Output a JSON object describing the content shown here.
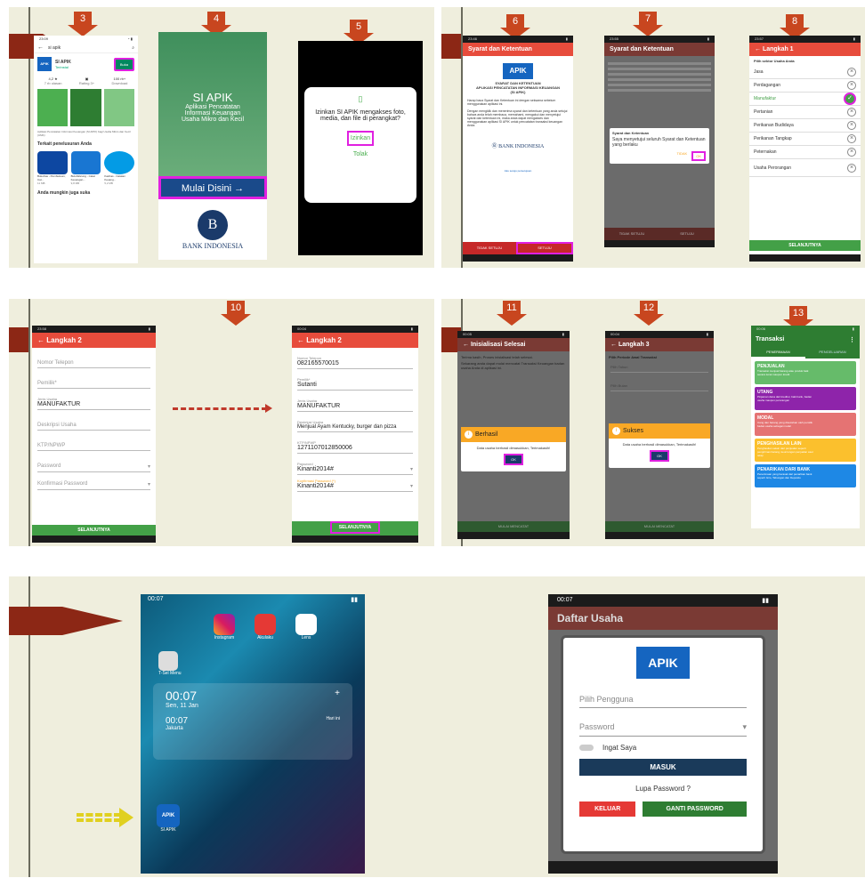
{
  "steps": [
    "3",
    "4",
    "5",
    "6",
    "7",
    "8",
    "10",
    "11",
    "12",
    "13"
  ],
  "s3": {
    "search": "si apik",
    "app_name": "SI APIK",
    "vendor": "Terinstal",
    "btn": "Buka",
    "rating": "4,2 ★",
    "rating_sub": "7 rb ulasan",
    "age": "Rating 3+",
    "downloads": "100 rb+",
    "downloads_sub": "Download",
    "desc": "Aplikasi Pencatatan Informasi Keuangan (SI APIK) bagi Usaha Mikro dan Kecil (UMK)",
    "related_title": "Terkait penelusuran Anda",
    "apps": [
      "BukuKas - Pembukuan, Cat...",
      "BukuWarung - Catat Keuangan...",
      "KasKas - Catatan Keuang..."
    ],
    "app_sizes": [
      "11 MB",
      "9,8 MB",
      "5,2 MB"
    ],
    "maybe": "Anda mungkin juga suka"
  },
  "s4": {
    "title": "SI APIK",
    "sub1": "Aplikasi Pencatatan",
    "sub2": "Informasi Keuangan",
    "sub3": "Usaha Mikro dan Kecil",
    "btn": "Mulai Disini",
    "bank": "BANK INDONESIA"
  },
  "s5": {
    "question": "Izinkan SI APIK mengakses foto, media, dan file di perangkat?",
    "allow": "Izinkan",
    "deny": "Tolak"
  },
  "s6": {
    "header": "Syarat dan Ketentuan",
    "logo": "APIK",
    "h1": "SYARAT DAN KETENTUAN",
    "h2": "APLIKASI PENCATATAN INFORMASI KEUANGAN",
    "h3": "(SI APIK)",
    "p1": "Harap baca Syarat dan Ketentuan ini dengan seksama sebelum menggunakan aplikasi ini.",
    "p2": "Dengan mengklik dan menerima syarat dan ketentuan yang anda setujui bahwa anda telah membaca, memahami, mengakui dan menyetujui syarat dan ketentuan ini, maka anda dapat mengakses dan menggunakan aplikasi SI APIK untuk pencatatan transaksi keuangan Anda.",
    "bank": "BANK INDONESIA",
    "link": "Aku setuju persetujuan",
    "reject": "TIDAK SETUJU",
    "accept": "SETUJU"
  },
  "s7": {
    "header": "Syarat dan Ketentuan",
    "dlg_title": "Syarat dan Ketentuan",
    "dlg_text": "Saya menyetujui seluruh Syarat dan Ketentuan yang berlaku",
    "cancel": "TIDAK",
    "ok": "OK",
    "reject": "TIDAK SETUJU",
    "accept": "SETUJU"
  },
  "s8": {
    "header": "Langkah 1",
    "label": "Pilih sektor Usaha Anda",
    "items": [
      "Jasa",
      "Perdagangan",
      "Manufaktur",
      "Pertanian",
      "Perikanan Budidaya",
      "Perikanan Tangkap",
      "Peternakan",
      "Usaha Perorangan"
    ],
    "btn": "SELANJUTNYA"
  },
  "s9": {
    "header": "Langkah 2",
    "fields": [
      "Nomor Telepon",
      "Pemilik*",
      "MANUFAKTUR",
      "Deskripsi Usaha",
      "KTP/NPWP",
      "Password",
      "Konfirmasi Password"
    ],
    "jenis": "Jenis Usaha",
    "btn": "SELANJUTNYA"
  },
  "s10": {
    "header": "Langkah 2",
    "labels": [
      "Nomor Telepon",
      "Pemilik*",
      "Jenis Usaha",
      "Deskripsi Usaha",
      "KTP/NPWP",
      "Password",
      "Konfirmasi Password (*)"
    ],
    "values": [
      "082165570015",
      "Sutanti",
      "MANUFAKTUR",
      "Menjual Ayam Kentucky, burger dan pizza",
      "1271107012850006",
      "Kinanti2014#",
      "Kinanti2014#"
    ],
    "btn": "SELANJUTNYA"
  },
  "s11": {
    "header": "Inisialisasi Selesai",
    "text1": "Terima kasih, Proses inisialisasi telah selesai.",
    "text2": "Sekarang anda dapat mulai mencatat Transaksi Keuangan badan usaha Anda di aplikasi ini.",
    "dlg_title": "Berhasil",
    "dlg_text": "Data usaha berhasil dimasukkan, Terimakasih!",
    "ok": "OK",
    "bottom": "MULAI MENCATAT"
  },
  "s12": {
    "header": "Langkah 3",
    "label": "Pilih Periode Awal Transaksi",
    "f1": "Pilih Tahun",
    "f2": "Pilih Bulan",
    "dlg_title": "Sukses",
    "dlg_text": "Data usaha berhasil dimasukkan, Terimakasih!",
    "ok": "OK",
    "bottom": "MULAI MENCATAT"
  },
  "s13": {
    "header": "Transaksi",
    "tab1": "PENERIMAAN",
    "tab2": "PENGELUARAN",
    "cats": [
      {
        "t": "PENJUALAN",
        "d": "Transaksi menjual barang atau produk baik secara tunai maupun kredit",
        "c": "#66bb6a"
      },
      {
        "t": "UTANG",
        "d": "Pinjaman dana dari kreditur, baik bank, badan usaha maupun perorangan",
        "c": "#8e24aa"
      },
      {
        "t": "MODAL",
        "d": "Uang dan barang yang disetorkan oleh pemilik badan usaha sebagai modal",
        "c": "#e57373"
      },
      {
        "t": "PENGHASILAN LAIN",
        "d": "Penghasilan selain dari penjualan seperti pengiriman barang, keuntungan penjualan aset tetap",
        "c": "#fbc02d"
      },
      {
        "t": "PENARIKAN DARI BANK",
        "d": "Penerimaan yang berasal dari penarikan bank seperti Giro, Tabungan dan Deposito",
        "c": "#1e88e5"
      }
    ]
  },
  "home": {
    "time": "00:07",
    "apps": [
      "Instagram",
      "Akulaku",
      "Lens"
    ],
    "folder": "T-Sel Menu",
    "clock1": "00:07",
    "date1": "Sen, 11 Jan",
    "clock2": "00:07",
    "city2": "Jakarta",
    "tz2": "Hari ini",
    "apik": "SI APIK"
  },
  "login": {
    "time": "00:07",
    "header": "Daftar Usaha",
    "logo": "APIK",
    "user": "Pilih Pengguna",
    "pass": "Password",
    "remember": "Ingat Saya",
    "login": "MASUK",
    "forgot": "Lupa Password ?",
    "exit": "KELUAR",
    "change": "GANTI PASSWORD"
  },
  "colors": {
    "accent": "#e74c3c",
    "green": "#43a047",
    "highlight": "#e020e0",
    "bg": "#efeedd",
    "arrow": "#c8461f"
  }
}
